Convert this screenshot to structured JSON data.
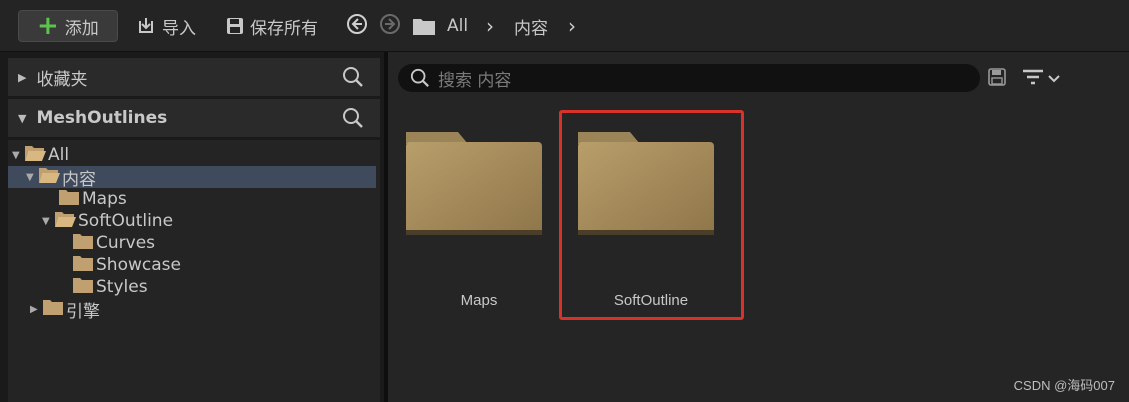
{
  "toolbar": {
    "add_label": "添加",
    "import_label": "导入",
    "save_all_label": "保存所有",
    "breadcrumb": [
      "All",
      "内容"
    ]
  },
  "left_panel": {
    "favorites_label": "收藏夹",
    "project_label": "MeshOutlines",
    "tree": [
      {
        "label": "All"
      },
      {
        "label": "内容"
      },
      {
        "label": "Maps"
      },
      {
        "label": "SoftOutline"
      },
      {
        "label": "Curves"
      },
      {
        "label": "Showcase"
      },
      {
        "label": "Styles"
      },
      {
        "label": "引擎"
      }
    ]
  },
  "right_panel": {
    "search_placeholder": "搜索 内容",
    "tiles": [
      {
        "label": "Maps"
      },
      {
        "label": "SoftOutline"
      }
    ]
  },
  "watermark": "CSDN @海码007",
  "colors": {
    "accent_add": "#5cc34d",
    "selected_row": "#3f4a5c",
    "highlight_box": "#d9322b",
    "folder": "#a08858"
  }
}
